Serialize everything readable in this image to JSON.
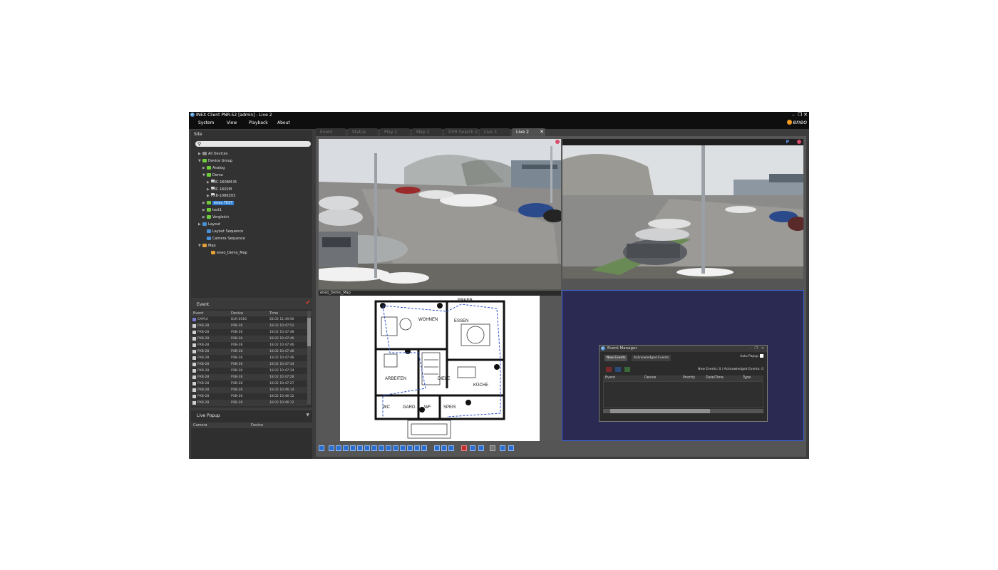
{
  "window": {
    "title": "INEX Client PNR-52 [admin] - Live 2",
    "controls": [
      "–",
      "❐",
      "✕"
    ],
    "brand": "eneo"
  },
  "menu": [
    "System",
    "View",
    "Playback",
    "About"
  ],
  "site": {
    "title": "Site",
    "search_placeholder": "",
    "tree": [
      {
        "label": "All Devices",
        "icon": "grey",
        "arrow": "▶"
      },
      {
        "label": "Device Group",
        "icon": "green",
        "arrow": "▼"
      },
      {
        "label": "Analog",
        "icon": "green",
        "arrow": "▶"
      },
      {
        "label": "Demo",
        "icon": "green",
        "arrow": "▼"
      },
      {
        "label": "GXC-1608M-IR",
        "icon": "cam",
        "arrow": "▶"
      },
      {
        "label": "NXC-1602M",
        "icon": "cam",
        "arrow": "▶"
      },
      {
        "label": "PXB-1080Z03",
        "icon": "cam",
        "arrow": "▶"
      },
      {
        "label": "eneo TEST",
        "icon": "green",
        "arrow": "▶",
        "selected": true
      },
      {
        "label": "test1",
        "icon": "green",
        "arrow": "▶"
      },
      {
        "label": "Vergleich",
        "icon": "green",
        "arrow": "▶"
      },
      {
        "label": "Layout",
        "icon": "blue",
        "arrow": "▶"
      },
      {
        "label": "Layout Sequence",
        "icon": "blue",
        "arrow": ""
      },
      {
        "label": "Camera Sequence",
        "icon": "blue",
        "arrow": ""
      },
      {
        "label": "Map",
        "icon": "orange",
        "arrow": "▼"
      },
      {
        "label": "eneo_Demo_Map",
        "icon": "orange",
        "arrow": ""
      }
    ]
  },
  "event": {
    "title": "Event",
    "columns": [
      "Event",
      "Device",
      "Time"
    ],
    "rows": [
      {
        "event": "CAP14",
        "device": "DLR-2016",
        "time": "28.02 11:49:50"
      },
      {
        "event": "PXB-28",
        "device": "PXB-28",
        "time": "18.02 10:47:52"
      },
      {
        "event": "PXB-28",
        "device": "PXB-28",
        "time": "18.02 10:47:48"
      },
      {
        "event": "PXB-28",
        "device": "PXB-28",
        "time": "18.02 10:47:46"
      },
      {
        "event": "PXB-28",
        "device": "PXB-28",
        "time": "18.02 10:47:46"
      },
      {
        "event": "PXB-28",
        "device": "PXB-28",
        "time": "18.02 10:47:46"
      },
      {
        "event": "PXB-28",
        "device": "PXB-28",
        "time": "18.02 10:47:46"
      },
      {
        "event": "PXB-28",
        "device": "PXB-28",
        "time": "18.02 10:47:34"
      },
      {
        "event": "PXB-28",
        "device": "PXB-28",
        "time": "18.02 10:47:34"
      },
      {
        "event": "PXB-28",
        "device": "PXB-28",
        "time": "18.02 10:47:28"
      },
      {
        "event": "PXB-28",
        "device": "PXB-28",
        "time": "18.02 10:47:27"
      },
      {
        "event": "PXB-28",
        "device": "PXB-28",
        "time": "18.02 10:46:14"
      },
      {
        "event": "PXB-28",
        "device": "PXB-28",
        "time": "18.02 10:46:12"
      },
      {
        "event": "PXB-28",
        "device": "PXB-28",
        "time": "18.02 10:46:12"
      }
    ]
  },
  "live_popup": {
    "title": "Live Popup",
    "columns": [
      "Camera",
      "Device"
    ]
  },
  "tabs": [
    {
      "label": "Event",
      "active": false
    },
    {
      "label": "Status",
      "active": false
    },
    {
      "label": "Play 1",
      "active": false
    },
    {
      "label": "Map 2",
      "active": false
    },
    {
      "label": "DVR Search 2",
      "active": false
    },
    {
      "label": "Live 3",
      "active": false
    },
    {
      "label": "Live 2",
      "active": true
    }
  ],
  "tab_close": "✕",
  "map_view": {
    "label": "eneo_Demo_Map"
  },
  "camera_marker": "P",
  "floorplan_labels": [
    "ERKER",
    "WOHNEN",
    "ESSEN",
    "DIELE",
    "ARBEITEN",
    "WC",
    "GARD.",
    "WF",
    "SPEIS",
    "KÜCHE"
  ],
  "event_manager": {
    "title": "Event Manager",
    "tabs": [
      "New Events",
      "Acknowledged Events"
    ],
    "auto_popup": "Auto Popup",
    "counts": "New Events:  0 / Acknowledged Events:  0",
    "columns": [
      "Event",
      "Device",
      "Priority",
      "Date/Time",
      "Type"
    ]
  },
  "colors": {
    "accent": "#2f7fd6",
    "empty_view": "#2b2a52",
    "empty_view_border": "#3d66d6",
    "record": "#d94a6a"
  }
}
